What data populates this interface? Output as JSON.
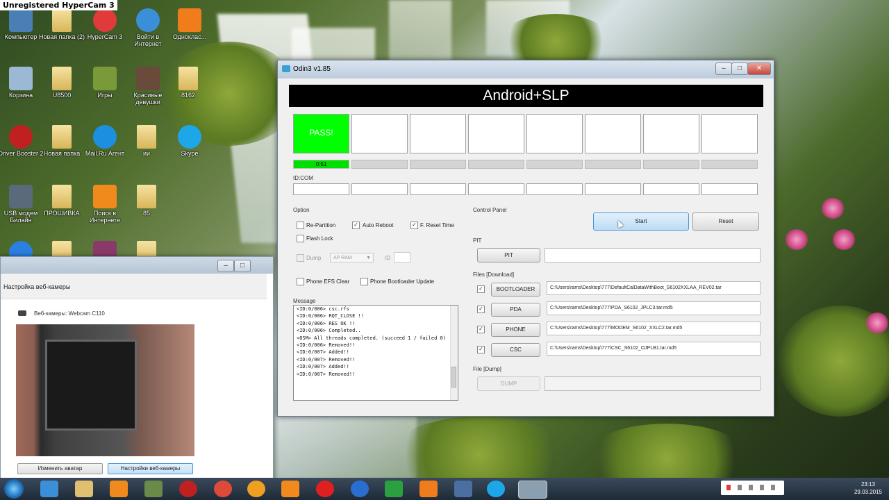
{
  "recorder_watermark": "Unregistered HyperCam 3",
  "desktop": {
    "icons": [
      {
        "label": "Компьютер",
        "name": "computer-icon",
        "color": "#4a7fb5"
      },
      {
        "label": "Новая папка (2)",
        "name": "folder-icon",
        "color": "#e0c070"
      },
      {
        "label": "HyperCam 3",
        "name": "hypercam-icon",
        "color": "#e03a3a"
      },
      {
        "label": "Войти в Интернет",
        "name": "ie-icon",
        "color": "#3a8fd8"
      },
      {
        "label": "Одноклас...",
        "name": "odnoklassniki-icon",
        "color": "#f07c1c"
      },
      {
        "label": "Корзина",
        "name": "recycle-bin-icon",
        "color": "#9bb8d4"
      },
      {
        "label": "U8500",
        "name": "folder-icon",
        "color": "#e0c070"
      },
      {
        "label": "Игры",
        "name": "games-icon",
        "color": "#7a9a3a"
      },
      {
        "label": "Красивые девушки",
        "name": "photo-icon",
        "color": "#6a4a3a"
      },
      {
        "label": "8162",
        "name": "folder-icon",
        "color": "#e0c070"
      },
      {
        "label": "Driver Booster 2",
        "name": "driver-booster-icon",
        "color": "#c02020"
      },
      {
        "label": "Новая папка",
        "name": "folder-icon",
        "color": "#e0c070"
      },
      {
        "label": "Mail.Ru Агент",
        "name": "mail-agent-icon",
        "color": "#1c8fe0"
      },
      {
        "label": "ии",
        "name": "folder-icon",
        "color": "#e0c070"
      },
      {
        "label": "Skype",
        "name": "skype-icon",
        "color": "#1ea7e8"
      },
      {
        "label": "USB модем Билайн",
        "name": "usb-modem-icon",
        "color": "#5a6a7a"
      },
      {
        "label": "ПРОШИВКА",
        "name": "folder-icon",
        "color": "#e0c070"
      },
      {
        "label": "Поиск в Интернете",
        "name": "search-icon",
        "color": "#f08a1c"
      },
      {
        "label": "85",
        "name": "folder-icon",
        "color": "#e0c070"
      }
    ]
  },
  "odin": {
    "title": "Odin3 v1.85",
    "banner": "Android+SLP",
    "slot1_status": "PASS!",
    "slot1_time": "0:51",
    "idcom_label": "ID:COM",
    "option_label": "Option",
    "options": {
      "re_partition": "Re-Partition",
      "auto_reboot": "Auto Reboot",
      "f_reset_time": "F. Reset Time",
      "flash_lock": "Flash Lock",
      "dump": "Dump",
      "dump_select": "AP RAM",
      "id_label": "ID",
      "phone_efs_clear": "Phone EFS Clear",
      "phone_bootloader_update": "Phone Bootloader Update"
    },
    "message_label": "Message",
    "messages": [
      "<ID:0/006> csc.rfs",
      "<ID:0/006> RQT_CLOSE !!",
      "<ID:0/006> RES OK !!",
      "<ID:0/006> Completed..",
      "<OSM> All threads completed. (succeed 1 / failed 0)",
      "<ID:0/006> Removed!!",
      "<ID:0/007> Added!!",
      "<ID:0/007> Removed!!",
      "<ID:0/007> Added!!",
      "<ID:0/007> Removed!!"
    ],
    "control_panel_label": "Control Panel",
    "start_label": "Start",
    "reset_label": "Reset",
    "pit_label": "PIT",
    "pit_button": "PIT",
    "files_label": "Files [Download]",
    "files": [
      {
        "button": "BOOTLOADER",
        "path": "C:\\Users\\rams\\Desktop\\777\\DefaultCalDataWithBoot_S6102XXLAA_REV02.tar"
      },
      {
        "button": "PDA",
        "path": "C:\\Users\\rams\\Desktop\\777\\PDA_S6102_JPLC3.tar.md5"
      },
      {
        "button": "PHONE",
        "path": "C:\\Users\\rams\\Desktop\\777\\MODEM_S6102_XXLC2.tar.md5"
      },
      {
        "button": "CSC",
        "path": "C:\\Users\\rams\\Desktop\\777\\CSC_S6102_OJPLB1.tar.md5"
      }
    ],
    "file_dump_label": "File [Dump]",
    "dump_button": "DUMP"
  },
  "webcam": {
    "title": "Настройка веб-камеры",
    "camera_label": "Веб-камеры: Webcam C110",
    "change_avatar": "Изменить аватар",
    "webcam_settings": "Настройки веб-камеры"
  },
  "taskbar": {
    "clock_time": "23:13",
    "clock_date": "29.03.2015"
  }
}
